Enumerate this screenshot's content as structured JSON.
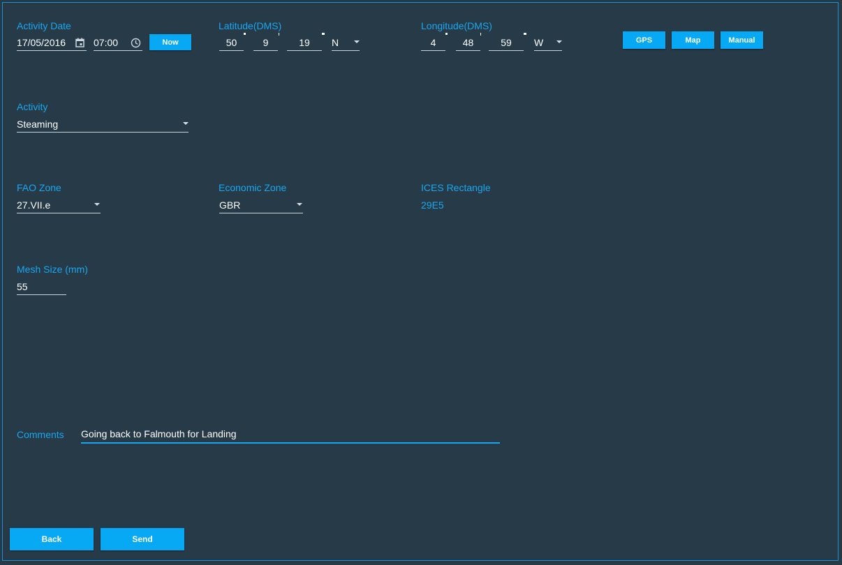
{
  "activity_date": {
    "label": "Activity Date",
    "date": "17/05/2016",
    "time": "07:00",
    "now_button": "Now",
    "calendar_icon": "calendar-icon",
    "clock_icon": "clock-icon"
  },
  "latitude": {
    "label": "Latitude(DMS)",
    "degrees": "50",
    "minutes": "9",
    "seconds": "19",
    "hemisphere": "N"
  },
  "longitude": {
    "label": "Longitude(DMS)",
    "degrees": "4",
    "minutes": "48",
    "seconds": "59",
    "hemisphere": "W"
  },
  "position_buttons": {
    "gps": "GPS",
    "map": "Map",
    "manual": "Manual"
  },
  "activity": {
    "label": "Activity",
    "value": "Steaming"
  },
  "fao_zone": {
    "label": "FAO Zone",
    "value": "27.VII.e"
  },
  "economic_zone": {
    "label": "Economic Zone",
    "value": "GBR"
  },
  "ices_rectangle": {
    "label": "ICES Rectangle",
    "value": "29E5"
  },
  "mesh_size": {
    "label": "Mesh Size (mm)",
    "value": "55"
  },
  "comments": {
    "label": "Comments",
    "value": "Going back to Falmouth for Landing"
  },
  "footer": {
    "back": "Back",
    "send": "Send"
  },
  "colors": {
    "background": "#263a48",
    "accent": "#08a9f4",
    "label": "#1aa7f0"
  }
}
